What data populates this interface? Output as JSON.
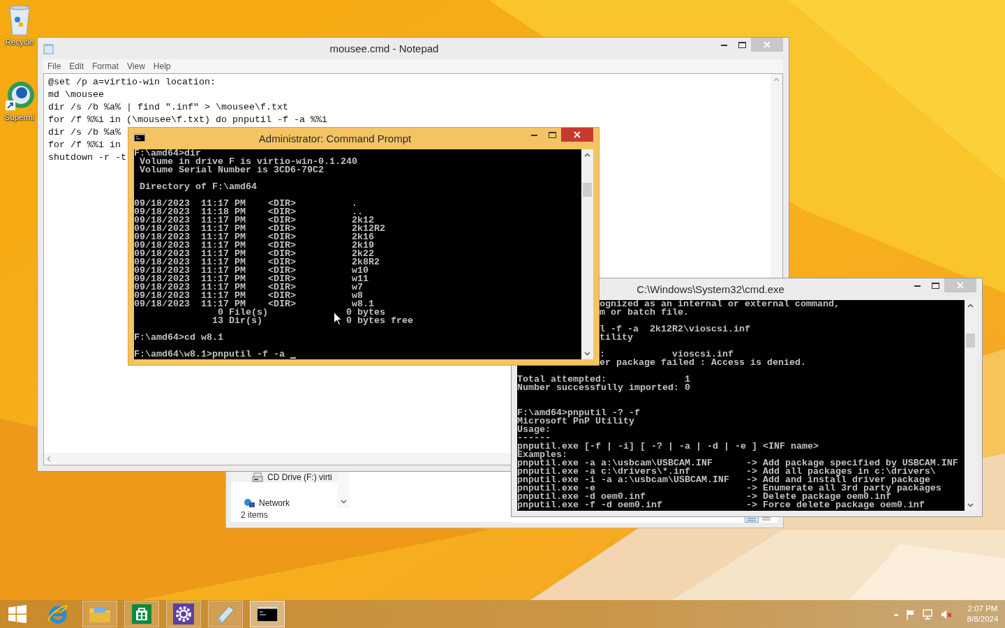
{
  "desktop_icons": [
    {
      "kind": "recycle",
      "label": "Recycle"
    },
    {
      "kind": "shortcut",
      "label": "Supermi"
    }
  ],
  "explorer": {
    "active": false,
    "nav_items": [
      {
        "kind": "drive",
        "label": "CD Drive (F:) virti"
      },
      {
        "kind": "network",
        "label": "Network"
      }
    ],
    "status": "2 items"
  },
  "notepad": {
    "title": "mousee.cmd - Notepad",
    "active": false,
    "menu": [
      "File",
      "Edit",
      "Format",
      "View",
      "Help"
    ],
    "lines": [
      "@set /p a=virtio-win location:",
      "md \\mousee",
      "dir /s /b %a% | find \".inf\" > \\mousee\\f.txt",
      "for /f %%i in (\\mousee\\f.txt) do pnputil -f -a %%i",
      "dir /s /b %a%",
      "for /f %%i in",
      "shutdown -r -t"
    ]
  },
  "console_windows": [
    {
      "title": "C:\\Windows\\System32\\cmd.exe",
      "active": false,
      "lines": [
        {
          "kind": "partial",
          "text": "ognized as an internal or external command,"
        },
        {
          "kind": "partial",
          "text": "m or batch file."
        },
        {
          "kind": "blank"
        },
        {
          "kind": "partial",
          "text": "l -f -a  2k12R2\\vioscsi.inf"
        },
        {
          "kind": "partial",
          "text": "tility"
        },
        {
          "kind": "blank"
        },
        {
          "kind": "partial",
          "text": ":            vioscsi.inf"
        },
        {
          "kind": "partial",
          "text": "er package failed : Access is denied."
        },
        {
          "kind": "blank"
        },
        {
          "kind": "text",
          "text": "Total attempted:              1"
        },
        {
          "kind": "text",
          "text": "Number successfully imported: 0"
        },
        {
          "kind": "blank"
        },
        {
          "kind": "blank"
        },
        {
          "kind": "text",
          "text": "F:\\amd64>pnputil -? -f"
        },
        {
          "kind": "text",
          "text": "Microsoft PnP Utility"
        },
        {
          "kind": "text",
          "text": "Usage:"
        },
        {
          "kind": "text",
          "text": "------"
        },
        {
          "kind": "text",
          "text": "pnputil.exe [-f | -i] [ -? | -a | -d | -e ] <INF name>"
        },
        {
          "kind": "text",
          "text": "Examples:"
        },
        {
          "kind": "text",
          "text": "pnputil.exe -a a:\\usbcam\\USBCAM.INF      -> Add package specified by USBCAM.INF"
        },
        {
          "kind": "text",
          "text": "pnputil.exe -a c:\\drivers\\*.inf          -> Add all packages in c:\\drivers\\"
        },
        {
          "kind": "text",
          "text": "pnputil.exe -i -a a:\\usbcam\\USBCAM.INF   -> Add and install driver package"
        },
        {
          "kind": "text",
          "text": "pnputil.exe -e                           -> Enumerate all 3rd party packages"
        },
        {
          "kind": "text",
          "text": "pnputil.exe -d oem0.inf                  -> Delete package oem0.inf"
        },
        {
          "kind": "text",
          "text": "pnputil.exe -f -d oem0.inf               -> Force delete package oem0.inf"
        }
      ]
    },
    {
      "title": "Administrator: Command Prompt",
      "active": true,
      "lines": [
        {
          "kind": "text",
          "text": "F:\\amd64>dir"
        },
        {
          "kind": "text",
          "text": " Volume in drive F is virtio-win-0.1.240"
        },
        {
          "kind": "text",
          "text": " Volume Serial Number is 3CD6-79C2"
        },
        {
          "kind": "blank"
        },
        {
          "kind": "text",
          "text": " Directory of F:\\amd64"
        },
        {
          "kind": "blank"
        },
        {
          "kind": "text",
          "text": "09/18/2023  11:17 PM    <DIR>          ."
        },
        {
          "kind": "text",
          "text": "09/18/2023  11:18 PM    <DIR>          .."
        },
        {
          "kind": "text",
          "text": "09/18/2023  11:17 PM    <DIR>          2k12"
        },
        {
          "kind": "text",
          "text": "09/18/2023  11:17 PM    <DIR>          2k12R2"
        },
        {
          "kind": "text",
          "text": "09/18/2023  11:17 PM    <DIR>          2k16"
        },
        {
          "kind": "text",
          "text": "09/18/2023  11:17 PM    <DIR>          2k19"
        },
        {
          "kind": "text",
          "text": "09/18/2023  11:17 PM    <DIR>          2k22"
        },
        {
          "kind": "text",
          "text": "09/18/2023  11:17 PM    <DIR>          2k8R2"
        },
        {
          "kind": "text",
          "text": "09/18/2023  11:17 PM    <DIR>          w10"
        },
        {
          "kind": "text",
          "text": "09/18/2023  11:17 PM    <DIR>          w11"
        },
        {
          "kind": "text",
          "text": "09/18/2023  11:17 PM    <DIR>          w7"
        },
        {
          "kind": "text",
          "text": "09/18/2023  11:17 PM    <DIR>          w8"
        },
        {
          "kind": "text",
          "text": "09/18/2023  11:17 PM    <DIR>          w8.1"
        },
        {
          "kind": "text",
          "text": "               0 File(s)              0 bytes"
        },
        {
          "kind": "columns",
          "cells": [
            "              13 Dir(s)",
            "0 bytes free"
          ]
        },
        {
          "kind": "blank"
        },
        {
          "kind": "text",
          "text": "F:\\amd64>cd w8.1"
        },
        {
          "kind": "blank"
        },
        {
          "kind": "prompt",
          "text": "F:\\amd64\\w8.1>pnputil -f -a "
        }
      ]
    }
  ],
  "taskbar": {
    "apps": [
      {
        "kind": "ie",
        "running": false,
        "selected": false
      },
      {
        "kind": "explorer",
        "running": true,
        "selected": false
      },
      {
        "kind": "store",
        "running": true,
        "selected": false
      },
      {
        "kind": "settings",
        "running": true,
        "selected": false
      },
      {
        "kind": "notepad",
        "running": true,
        "selected": false
      },
      {
        "kind": "cmd",
        "running": true,
        "selected": true
      }
    ],
    "clock": {
      "time": "2:07 PM",
      "date": "8/8/2024"
    }
  }
}
